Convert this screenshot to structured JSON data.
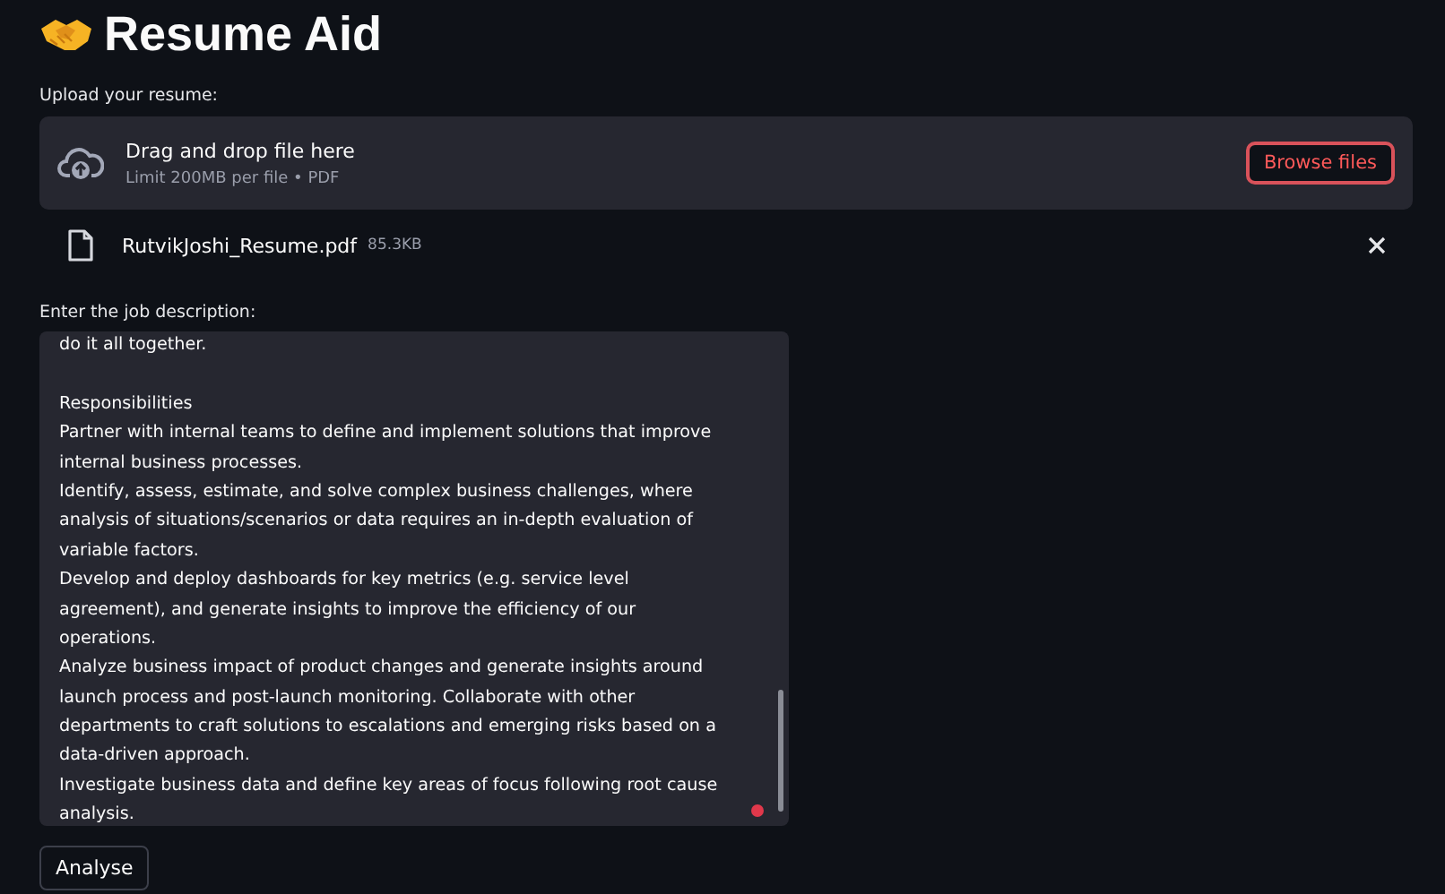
{
  "title": "Resume Aid",
  "upload": {
    "label": "Upload your resume:",
    "drop_text": "Drag and drop file here",
    "limit_text": "Limit 200MB per file • PDF",
    "button": "Browse files"
  },
  "file": {
    "name": "RutvikJoshi_Resume.pdf",
    "size": "85.3KB"
  },
  "job": {
    "label": "Enter the job description:",
    "blocks": [
      {
        "lines": [
          "do it all together."
        ]
      },
      {
        "lines": [
          "Responsibilities",
          "Partner with internal teams to define and implement solutions that improve",
          "internal business processes.",
          "Identify, assess, estimate, and solve complex business challenges, where",
          "analysis of situations/scenarios or data requires an in-depth evaluation of",
          "variable factors.",
          "Develop and deploy dashboards for key metrics (e.g. service level",
          "agreement), and generate insights to improve the efficiency of our",
          "operations.",
          "Analyze business impact of product changes and generate insights around",
          "launch process and post-launch monitoring. Collaborate with other",
          "departments to craft solutions to escalations and emerging risks based on a",
          "data-driven approach.",
          "Investigate business data and define key areas of focus following root cause",
          "analysis."
        ]
      }
    ]
  },
  "button": "Analyse"
}
